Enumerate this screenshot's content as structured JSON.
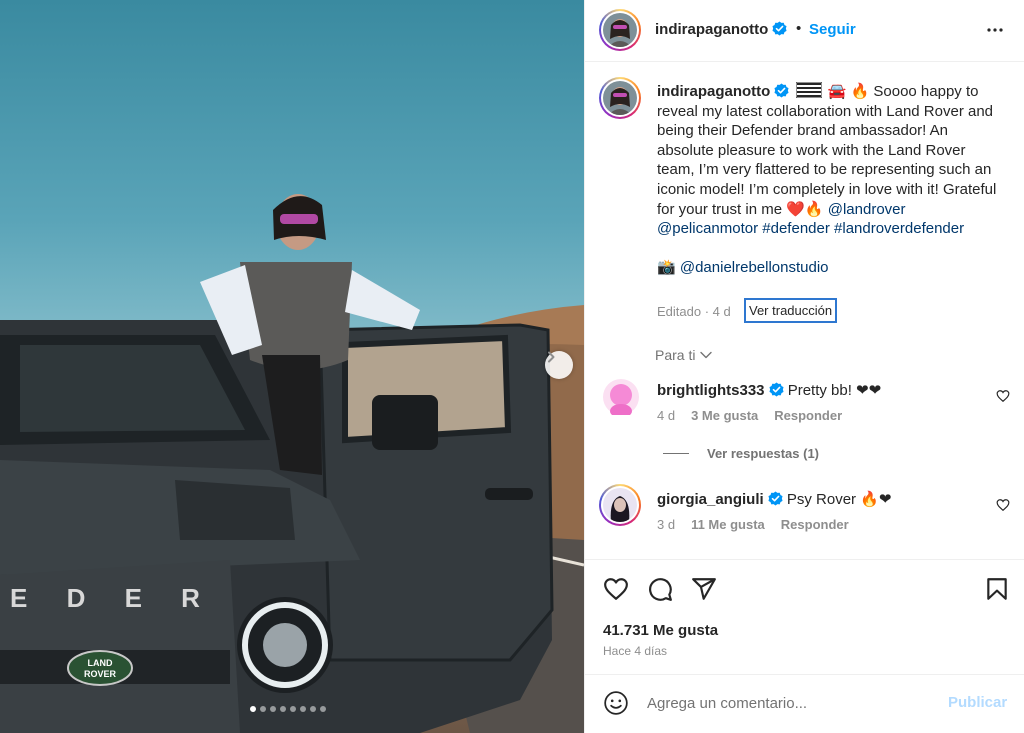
{
  "post": {
    "photo_alt": "",
    "slide_count": 8,
    "active_slide": 0
  },
  "header": {
    "username": "indirapaganotto",
    "separator": "•",
    "follow_label": "Seguir"
  },
  "caption": {
    "username": "indirapaganotto",
    "emoji_prefix": "🚘 🔥",
    "text": "Soooo happy to reveal my latest collaboration with Land Rover and being their Defender brand ambassador! An absolute pleasure to work with the Land Rover team, I’m very flattered to be representing such an iconic model! I’m completely in love with it! Grateful for your trust in me",
    "text_emoji": "❤️🔥",
    "mention1": "@landrover",
    "mention2": "@pelicanmotor",
    "hashtag1": "#defender",
    "hashtag2": "#landroverdefender",
    "photo_credit_emoji": "📸",
    "photo_credit": "@danielrebellonstudio",
    "edited": "Editado · 4 d",
    "translate_label": "Ver traducción"
  },
  "for_you_label": "Para ti",
  "comments": [
    {
      "username": "brightlights333",
      "text": "Pretty bb! ❤❤",
      "age": "4 d",
      "likes": "3 Me gusta",
      "reply_label": "Responder"
    },
    {
      "username": "giorgia_angiuli",
      "text": "Psy Rover 🔥❤",
      "age": "3 d",
      "likes": "11 Me gusta",
      "reply_label": "Responder"
    }
  ],
  "view_replies_label": "Ver respuestas (1)",
  "likes_count": "41.731 Me gusta",
  "posted_ago": "Hace 4 días",
  "comment_input": {
    "placeholder": "Agrega un comentario...",
    "value": ""
  },
  "publish_label": "Publicar",
  "colors": {
    "accent": "#0095f6",
    "link": "#00376b",
    "muted": "#8e8e8e",
    "verified": "#0095f6"
  }
}
